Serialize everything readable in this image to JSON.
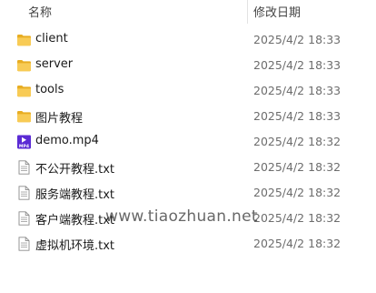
{
  "header": {
    "sort_indicator": "^",
    "name_column": "名称",
    "date_column": "修改日期"
  },
  "files": [
    {
      "name": "client",
      "modified": "2025/4/2 18:33",
      "icon": "folder-icon"
    },
    {
      "name": "server",
      "modified": "2025/4/2 18:33",
      "icon": "folder-icon"
    },
    {
      "name": "tools",
      "modified": "2025/4/2 18:33",
      "icon": "folder-icon"
    },
    {
      "name": "图片教程",
      "modified": "2025/4/2 18:33",
      "icon": "folder-icon"
    },
    {
      "name": "demo.mp4",
      "modified": "2025/4/2 18:32",
      "icon": "mp4-video-icon"
    },
    {
      "name": "不公开教程.txt",
      "modified": "2025/4/2 18:32",
      "icon": "text-file-icon"
    },
    {
      "name": "服务端教程.txt",
      "modified": "2025/4/2 18:32",
      "icon": "text-file-icon"
    },
    {
      "name": "客户端教程.txt",
      "modified": "2025/4/2 18:32",
      "icon": "text-file-icon"
    },
    {
      "name": "虚拟机环境.txt",
      "modified": "2025/4/2 18:32",
      "icon": "text-file-icon"
    }
  ],
  "watermark": "www.tiaozhuan.net",
  "colors": {
    "folder": "#f4c542",
    "video": "#5b2bd4",
    "text_primary": "#1a1a1a",
    "text_secondary": "#6d6d6d"
  }
}
